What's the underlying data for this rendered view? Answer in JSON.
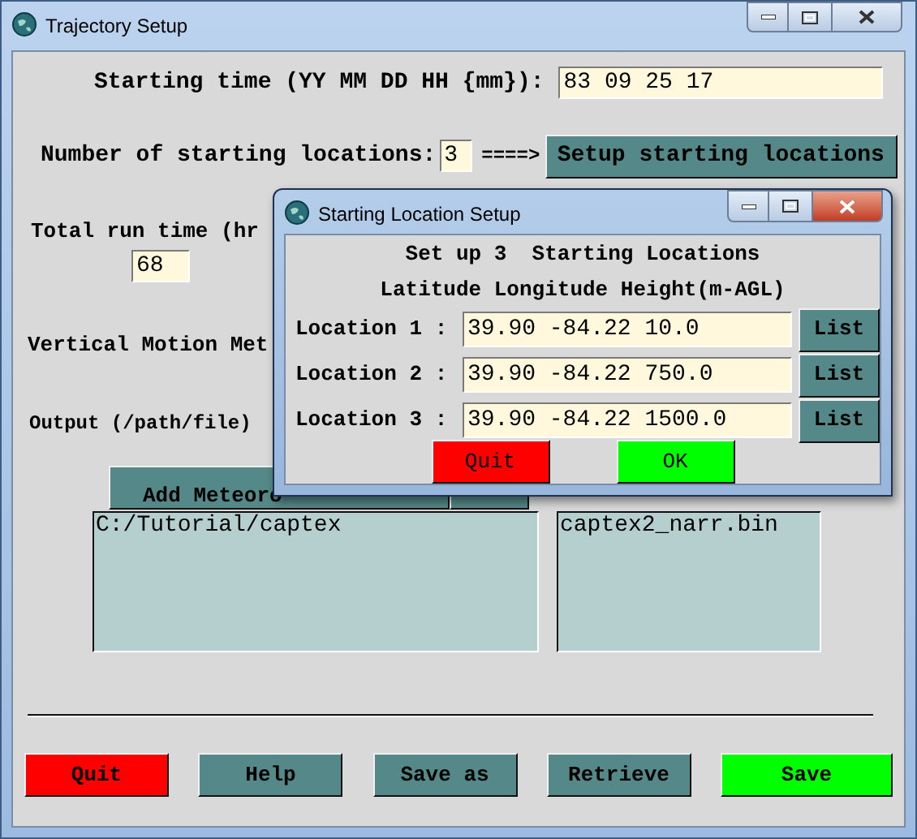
{
  "main_window": {
    "title": "Trajectory Setup",
    "starting_time": {
      "label": "Starting time (YY MM DD HH {mm}):",
      "value": "83 09 25 17"
    },
    "locations_count": {
      "label": "Number of starting locations:",
      "value": "3",
      "arrow": "====>",
      "button": "Setup starting locations"
    },
    "run_time": {
      "label": "Total run time (hr",
      "value": "68"
    },
    "vertical_motion": {
      "label": "Vertical Motion Met"
    },
    "output": {
      "label": "Output (/path/file)"
    },
    "add_meteorology": {
      "label": "Add Meteoro"
    },
    "directory_list": {
      "items": [
        "C:/Tutorial/captex"
      ]
    },
    "files_list": {
      "items": [
        "captex2_narr.bin"
      ]
    },
    "buttons": [
      {
        "label": "Quit",
        "color": "#ff0000"
      },
      {
        "label": "Help",
        "color": "#558888"
      },
      {
        "label": "Save as",
        "color": "#558888"
      },
      {
        "label": "Retrieve",
        "color": "#558888"
      },
      {
        "label": "Save",
        "color": "#00ff00"
      }
    ]
  },
  "dialog": {
    "title": "Starting Location Setup",
    "heading": "Set up 3  Starting Locations",
    "columns_label": "Latitude Longitude Height(m-AGL)",
    "locations": [
      {
        "label": "Location 1 :",
        "value": "39.90 -84.22 10.0",
        "button": "List"
      },
      {
        "label": "Location 2 :",
        "value": "39.90 -84.22 750.0",
        "button": "List"
      },
      {
        "label": "Location 3 :",
        "value": "39.90 -84.22 1500.0",
        "button": "List"
      }
    ],
    "buttons": [
      {
        "label": "Quit",
        "color": "#ff0000"
      },
      {
        "label": "OK",
        "color": "#00ff00"
      }
    ]
  }
}
